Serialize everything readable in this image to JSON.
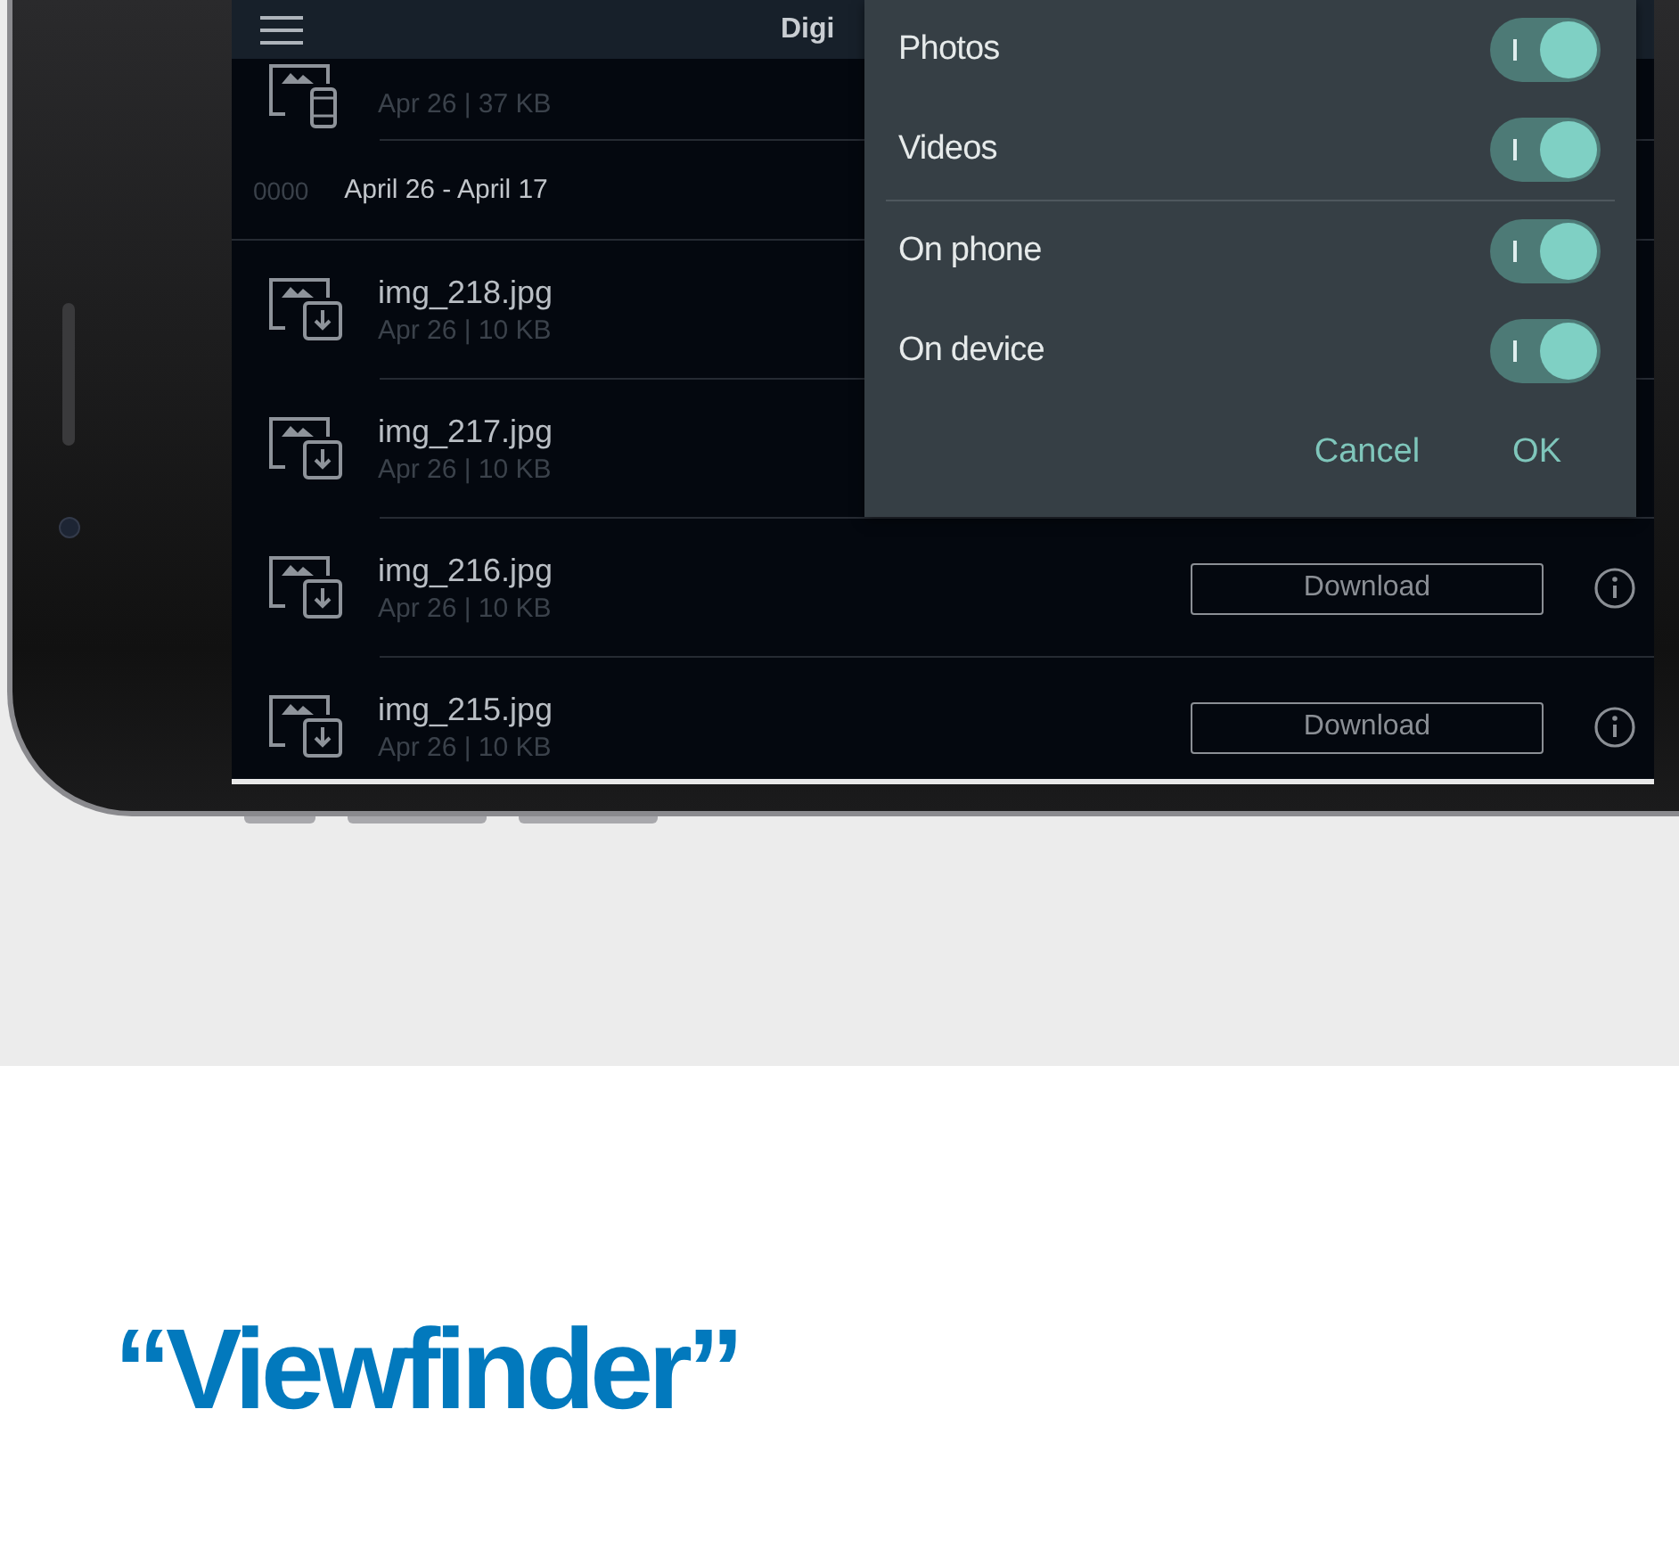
{
  "app_bar": {
    "title": "Digi"
  },
  "list": {
    "top_row": {
      "kind": "device",
      "meta": "Apr 26 | 37 KB"
    },
    "section": {
      "code": "0000",
      "range": "April 26 - April 17"
    },
    "rows": [
      {
        "kind": "download",
        "name": "img_218.jpg",
        "meta": "Apr 26 | 10 KB"
      },
      {
        "kind": "download",
        "name": "img_217.jpg",
        "meta": "Apr 26 | 10 KB"
      },
      {
        "kind": "download",
        "name": "img_216.jpg",
        "meta": "Apr 26 | 10 KB",
        "button": "Download"
      },
      {
        "kind": "download",
        "name": "img_215.jpg",
        "meta": "Apr 26 | 10 KB",
        "button": "Download"
      }
    ]
  },
  "dialog": {
    "groups": [
      [
        {
          "label": "Photos",
          "on": true
        },
        {
          "label": "Videos",
          "on": true
        }
      ],
      [
        {
          "label": "On phone",
          "on": true
        },
        {
          "label": "On device",
          "on": true
        }
      ]
    ],
    "buttons": [
      "Cancel",
      "OK"
    ]
  },
  "heading": "“Viewfinder”"
}
